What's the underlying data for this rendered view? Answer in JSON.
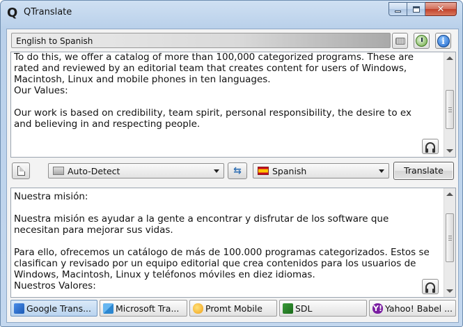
{
  "window": {
    "title": "QTranslate",
    "app_icon_glyph": "Q",
    "close_glyph": "✕"
  },
  "toolbar": {
    "direction_label": "English to Spanish",
    "keyboard_icon": "keyboard-icon",
    "history_icon": "history-icon",
    "info_icon": "info-icon"
  },
  "source": {
    "lines": [
      "To do this, we offer a catalog of more than 100,000 categorized programs. These are",
      "rated and reviewed by an editorial team that creates content for users of Windows,",
      "Macintosh, Linux and mobile phones in ten languages.",
      "Our Values:",
      "",
      "Our work is based on credibility, team spirit, personal responsibility, the desire to ex",
      "and believing in and respecting people."
    ]
  },
  "controls": {
    "source_language": "Auto-Detect",
    "target_language": "Spanish",
    "swap_glyph": "⇆",
    "translate_label": "Translate"
  },
  "output": {
    "lines": [
      "Nuestra misión:",
      "",
      "Nuestra misión es ayudar a la gente a encontrar y disfrutar de los software que",
      "necesitan para mejorar sus vidas.",
      "",
      "Para ello, ofrecemos un catálogo de más de 100.000 programas categorizados. Estos se",
      "clasifican y revisado por un equipo editorial que crea contenidos para los usuarios de",
      "Windows, Macintosh, Linux y teléfonos móviles en diez idiomas.",
      "Nuestros Valores:"
    ]
  },
  "engines": [
    {
      "label": "Google Trans...",
      "icon": "google-translate-icon",
      "active": true
    },
    {
      "label": "Microsoft Tra...",
      "icon": "microsoft-translator-icon",
      "active": false
    },
    {
      "label": "Promt Mobile",
      "icon": "promt-icon",
      "active": false
    },
    {
      "label": "SDL",
      "icon": "sdl-icon",
      "active": false
    },
    {
      "label": "Yahoo! Babel ...",
      "icon": "yahoo-icon",
      "glyph": "Y!",
      "active": false
    }
  ],
  "colors": {
    "title_bar": "#c3d7ee",
    "close_button": "#c1412a",
    "active_engine": "#b9d4ef"
  }
}
